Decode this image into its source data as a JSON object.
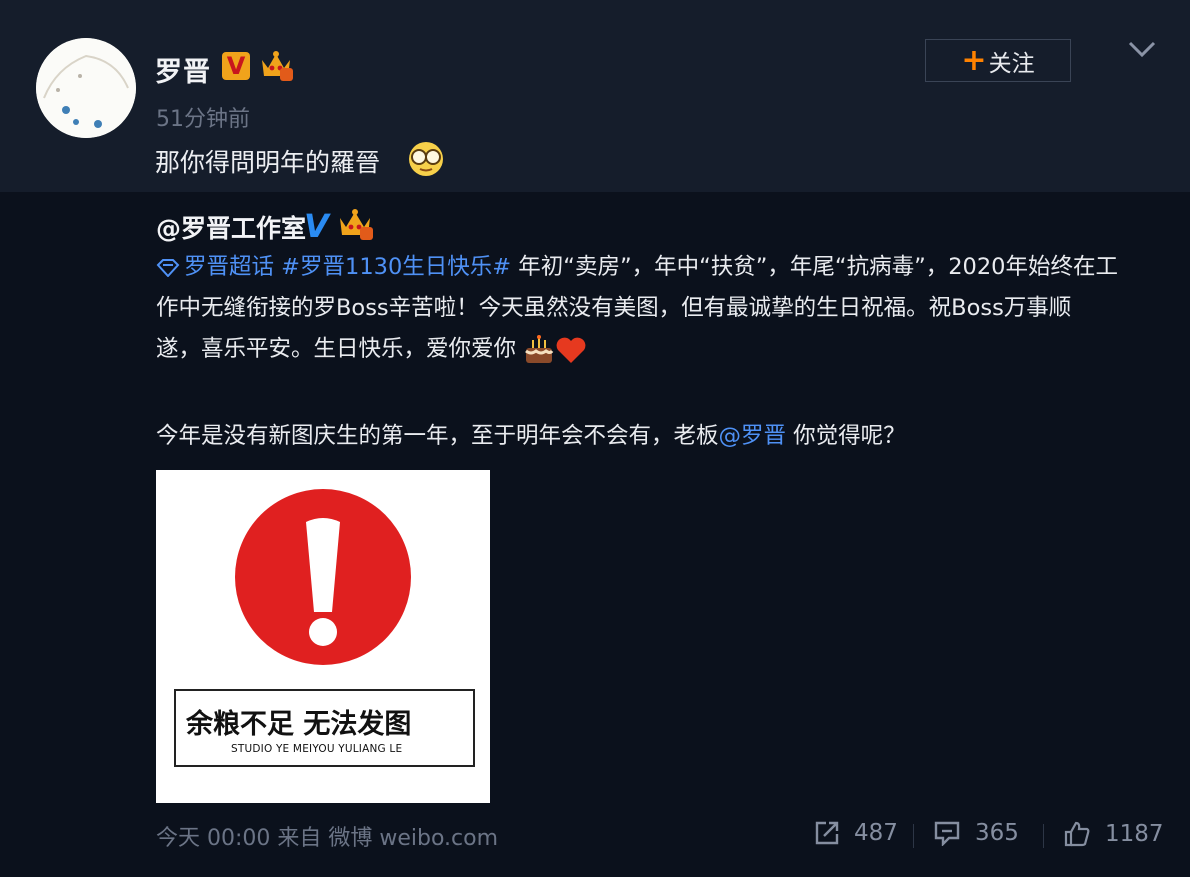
{
  "post": {
    "author": "罗晋",
    "verified_mark": "V",
    "time": "51分钟前",
    "text": "那你得問明年的羅晉",
    "follow_plus": "+",
    "follow_label": "关注"
  },
  "repost": {
    "author": "@罗晋工作室",
    "verified_mark": "V",
    "topic_super": "罗晋超话",
    "hashtag": "#罗晋1130生日快乐#",
    "line1_rest": " 年初“卖房”，年中“扶贫”，年尾“抗病毒”，2020年始终在工",
    "line2": "作中无缝衔接的罗Boss辛苦啦！今天虽然没有美图，但有最诚挚的生日祝福。祝Boss万事顺",
    "line3": "遂，喜乐平安。生日快乐，爱你爱你",
    "line4_before": "今年是没有新图庆生的第一年，至于明年会不会有，老板",
    "mention": "@罗晋",
    "line4_after": " 你觉得呢？",
    "image": {
      "title": "余粮不足 无法发图",
      "subtitle": "STUDIO YE MEIYOU YULIANG LE",
      "alert_color": "#e02020"
    },
    "footer_time": "今天 00:00 来自 微博 weibo.com",
    "shares": "487",
    "comments": "365",
    "likes": "1187"
  },
  "colors": {
    "background": "#0b111c",
    "header_background": "#151d2b",
    "link": "#4f91f5",
    "vip_orange": "#f0a31b",
    "verified_blue": "#2a8bf2"
  },
  "icons": [
    "chevron-down-icon",
    "share-icon",
    "comment-icon",
    "like-icon",
    "super-topic-icon",
    "cake-emoji-icon",
    "heart-emoji-icon",
    "glasses-emoji-icon",
    "crown-vip-icon"
  ]
}
